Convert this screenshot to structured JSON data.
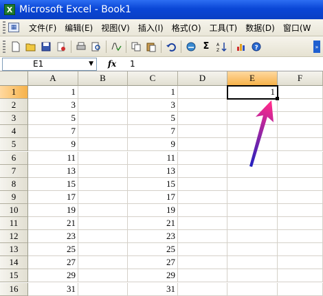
{
  "window": {
    "title": "Microsoft Excel - Book1",
    "app_icon": "X"
  },
  "menu": {
    "items": [
      "文件(F)",
      "编辑(E)",
      "视图(V)",
      "插入(I)",
      "格式(O)",
      "工具(T)",
      "数据(D)",
      "窗口(W"
    ]
  },
  "toolbar": {
    "icons": [
      "new-icon",
      "open-icon",
      "save-icon",
      "permission-icon",
      "print-icon",
      "print-preview-icon",
      "spelling-icon",
      "copy-icon",
      "paste-icon",
      "undo-icon",
      "hyperlink-icon",
      "autosum-icon",
      "sort-ascending-icon",
      "chart-icon",
      "help-icon"
    ],
    "sigma_label": "Σ"
  },
  "formula_bar": {
    "name_box": "E1",
    "fx": "fx",
    "value": "1"
  },
  "sheet": {
    "columns": [
      "A",
      "B",
      "C",
      "D",
      "E",
      "F"
    ],
    "active_column": "E",
    "active_row": "1",
    "rows": [
      {
        "num": "1",
        "A": "1",
        "C": "1",
        "E": "1"
      },
      {
        "num": "2",
        "A": "3",
        "C": "3"
      },
      {
        "num": "3",
        "A": "5",
        "C": "5"
      },
      {
        "num": "4",
        "A": "7",
        "C": "7"
      },
      {
        "num": "5",
        "A": "9",
        "C": "9"
      },
      {
        "num": "6",
        "A": "11",
        "C": "11"
      },
      {
        "num": "7",
        "A": "13",
        "C": "13"
      },
      {
        "num": "8",
        "A": "15",
        "C": "15"
      },
      {
        "num": "9",
        "A": "17",
        "C": "17"
      },
      {
        "num": "10",
        "A": "19",
        "C": "19"
      },
      {
        "num": "11",
        "A": "21",
        "C": "21"
      },
      {
        "num": "12",
        "A": "23",
        "C": "23"
      },
      {
        "num": "13",
        "A": "25",
        "C": "25"
      },
      {
        "num": "14",
        "A": "27",
        "C": "27"
      },
      {
        "num": "15",
        "A": "29",
        "C": "29"
      },
      {
        "num": "16",
        "A": "31",
        "C": "31"
      }
    ]
  },
  "colors": {
    "title_bar": "#0a46d6",
    "active_header": "#f6b24a",
    "arrow_start": "#2020c0",
    "arrow_end": "#ff2a8a"
  }
}
